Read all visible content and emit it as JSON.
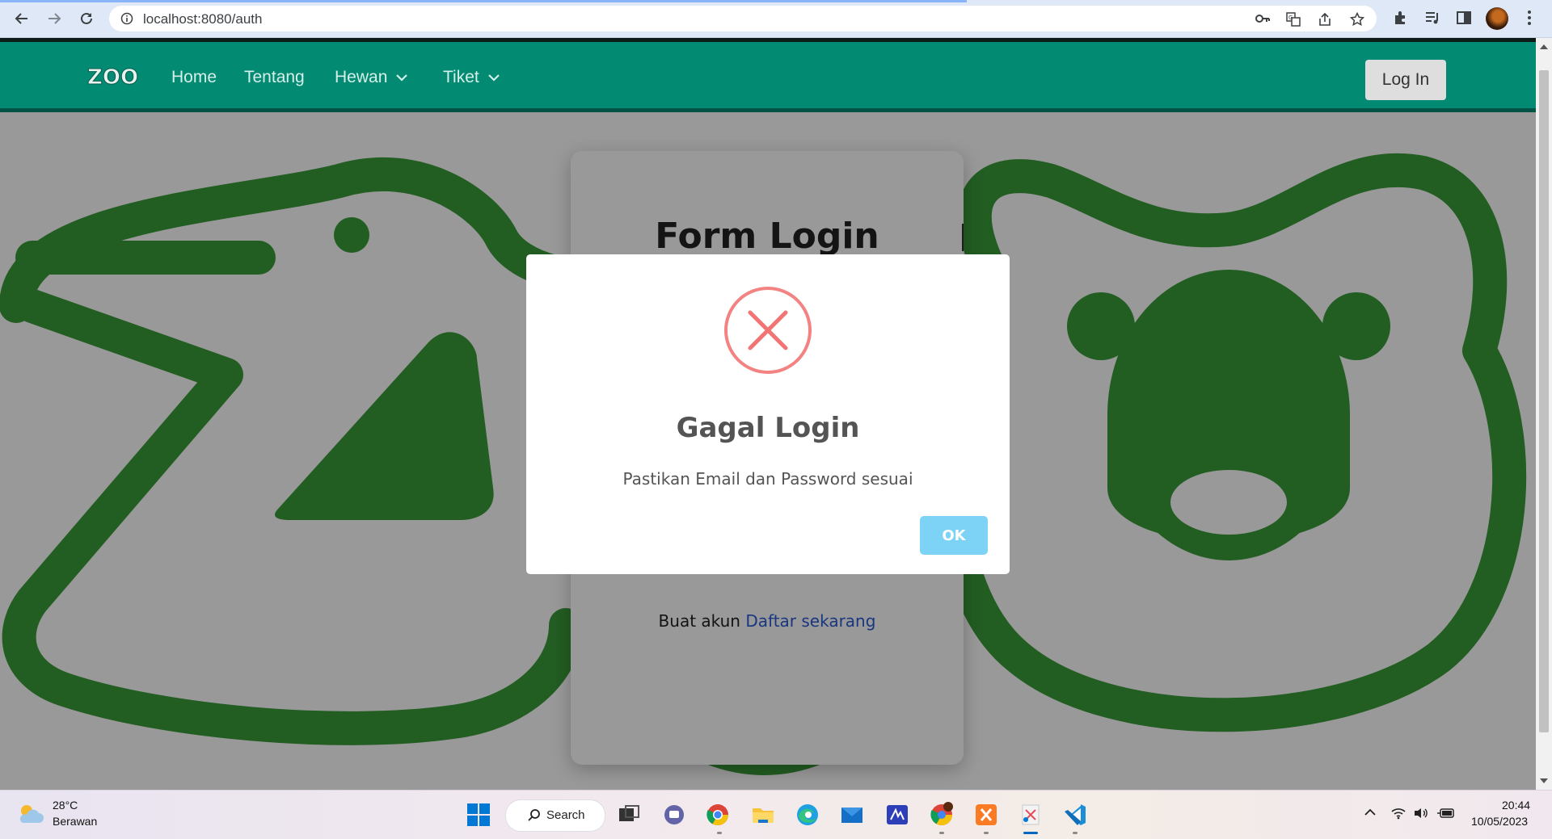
{
  "browser": {
    "url": "localhost:8080/auth"
  },
  "navbar": {
    "brand": "ZOO",
    "links": [
      "Home",
      "Tentang",
      "Hewan",
      "Tiket"
    ],
    "login_label": "Log In"
  },
  "form": {
    "title": "Form Login",
    "footer_text": "Buat akun",
    "footer_link": "Daftar sekarang"
  },
  "alert": {
    "icon": "error-x-icon",
    "title": "Gagal Login",
    "message": "Pastikan Email dan Password sesuai",
    "confirm_label": "OK",
    "colors": {
      "icon": "#f27474",
      "confirm": "#7dd3f5"
    }
  },
  "taskbar": {
    "weather_temp": "28°C",
    "weather_desc": "Berawan",
    "search_label": "Search",
    "clock_time": "20:44",
    "clock_date": "10/05/2023"
  },
  "colors": {
    "navbar": "#028a73",
    "art_green": "#3a9b3a"
  }
}
